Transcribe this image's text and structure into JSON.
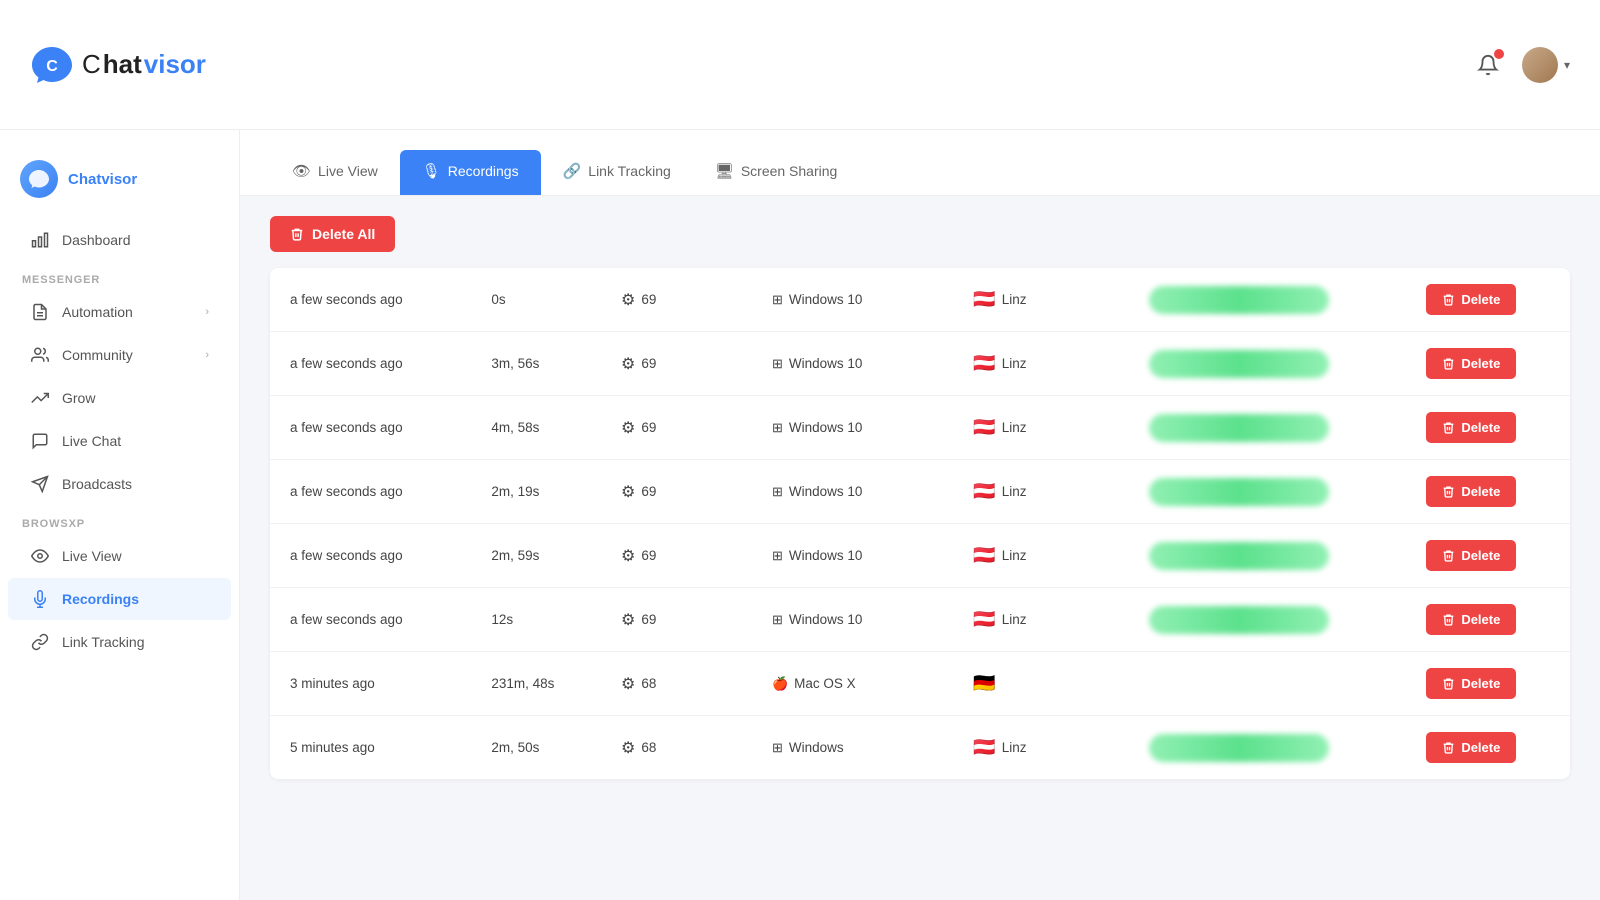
{
  "app": {
    "name": "Chatvisor",
    "logo_letter": "C"
  },
  "header": {
    "brand": "Chatvisor"
  },
  "sidebar": {
    "brand_name": "Chatvisor",
    "items_top": [
      {
        "id": "dashboard",
        "label": "Dashboard",
        "icon": "bar-chart"
      },
      {
        "id": "automation",
        "label": "Automation",
        "icon": "file",
        "has_arrow": true
      },
      {
        "id": "community",
        "label": "Community",
        "icon": "people",
        "has_arrow": true
      },
      {
        "id": "grow",
        "label": "Grow",
        "icon": "trending-up"
      },
      {
        "id": "live-chat",
        "label": "Live Chat",
        "icon": "chat"
      },
      {
        "id": "broadcasts",
        "label": "Broadcasts",
        "icon": "send"
      }
    ],
    "section_browsxp": "BROWSXP",
    "items_bottom": [
      {
        "id": "live-view",
        "label": "Live View",
        "icon": "eye"
      },
      {
        "id": "recordings",
        "label": "Recordings",
        "icon": "mic",
        "active": true
      },
      {
        "id": "link-tracking",
        "label": "Link Tracking",
        "icon": "link"
      }
    ]
  },
  "tabs": [
    {
      "id": "live-view",
      "label": "Live View",
      "icon": "👁"
    },
    {
      "id": "recordings",
      "label": "Recordings",
      "icon": "🎙",
      "active": true
    },
    {
      "id": "link-tracking",
      "label": "Link Tracking",
      "icon": "🔗"
    },
    {
      "id": "screen-sharing",
      "label": "Screen Sharing",
      "icon": "🖥"
    }
  ],
  "toolbar": {
    "delete_all_label": "Delete All"
  },
  "table": {
    "rows": [
      {
        "time": "a few seconds ago",
        "duration": "0s",
        "browser_version": "69",
        "os": "Windows 10",
        "location": "Linz",
        "flag": "🇦🇹",
        "has_preview": true
      },
      {
        "time": "a few seconds ago",
        "duration": "3m, 56s",
        "browser_version": "69",
        "os": "Windows 10",
        "location": "Linz",
        "flag": "🇦🇹",
        "has_preview": true
      },
      {
        "time": "a few seconds ago",
        "duration": "4m, 58s",
        "browser_version": "69",
        "os": "Windows 10",
        "location": "Linz",
        "flag": "🇦🇹",
        "has_preview": true
      },
      {
        "time": "a few seconds ago",
        "duration": "2m, 19s",
        "browser_version": "69",
        "os": "Windows 10",
        "location": "Linz",
        "flag": "🇦🇹",
        "has_preview": true
      },
      {
        "time": "a few seconds ago",
        "duration": "2m, 59s",
        "browser_version": "69",
        "os": "Windows 10",
        "location": "Linz",
        "flag": "🇦🇹",
        "has_preview": true
      },
      {
        "time": "a few seconds ago",
        "duration": "12s",
        "browser_version": "69",
        "os": "Windows 10",
        "location": "Linz",
        "flag": "🇦🇹",
        "has_preview": true
      },
      {
        "time": "3 minutes ago",
        "duration": "231m, 48s",
        "browser_version": "68",
        "os": "Mac OS X",
        "location": "",
        "flag": "🇩🇪",
        "has_preview": false
      },
      {
        "time": "5 minutes ago",
        "duration": "2m, 50s",
        "browser_version": "68",
        "os": "Windows",
        "location": "Linz",
        "flag": "🇦🇹",
        "has_preview": true
      }
    ],
    "delete_label": "Delete"
  }
}
